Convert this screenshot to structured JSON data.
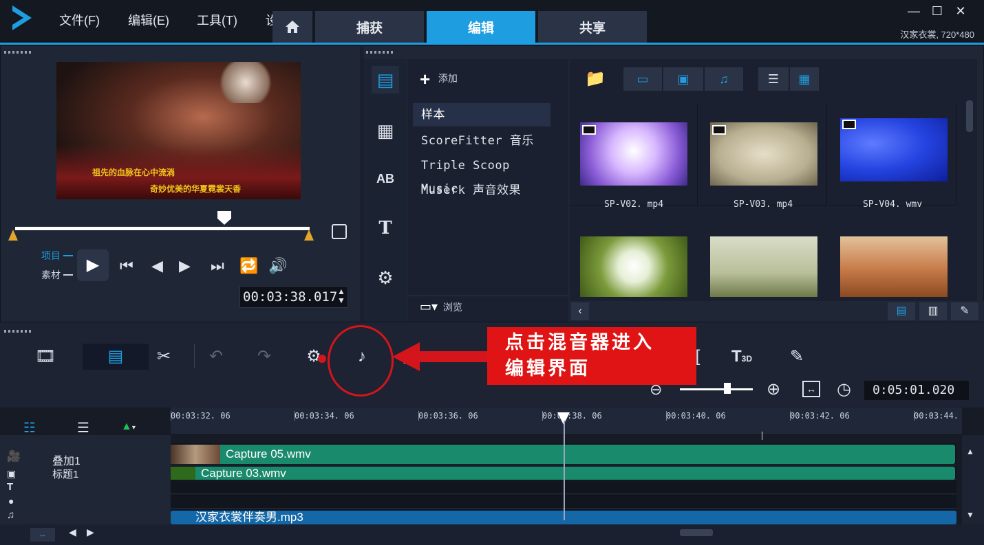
{
  "app": {
    "menu": [
      "文件(F)",
      "编辑(E)",
      "工具(T)",
      "设"
    ],
    "tabs": [
      "捕获",
      "编辑",
      "共享"
    ],
    "active_tab": "编辑",
    "project_info": "汉家衣裳, 720*480",
    "accent": "#1e9ee0"
  },
  "preview": {
    "lyrics": [
      "祖先的血脉在心中流淌",
      "奇妙优美的华夏霓裳天香"
    ],
    "mode_project": "项目",
    "mode_clip": "素材",
    "timecode": "00:03:38.017"
  },
  "library": {
    "add_label": "添加",
    "folders": [
      "样本",
      "ScoreFitter 音乐",
      "Triple Scoop Music",
      "Muserk 声音效果"
    ],
    "selected_folder": "样本",
    "browse_label": "浏览",
    "thumbnails": [
      {
        "name": "SP-V02. mp4",
        "kind": "video"
      },
      {
        "name": "SP-V03. mp4",
        "kind": "video"
      },
      {
        "name": "SP-V04. wmv",
        "kind": "video"
      },
      {
        "name": "",
        "kind": "image"
      },
      {
        "name": "",
        "kind": "image"
      },
      {
        "name": "",
        "kind": "image"
      }
    ]
  },
  "toolbar": {
    "total_time": "0:05:01.020",
    "annotation": [
      "点击混音器进入",
      "编辑界面"
    ],
    "annotation_color": "#e01414"
  },
  "timeline": {
    "ruler_ticks": [
      "00:03:32. 06",
      "00:03:34. 06",
      "00:03:36. 06",
      "00:03:38. 06",
      "00:03:40. 06",
      "00:03:42. 06",
      "00:03:44."
    ],
    "tracks": [
      {
        "name": "叠加1",
        "clip": "Capture 05.wmv"
      },
      {
        "name": "标题1",
        "clip": "Capture 03.wmv"
      },
      {
        "name": "",
        "clip": ""
      },
      {
        "name": "",
        "clip": ""
      },
      {
        "name": "",
        "clip": "汉家衣裳伴奏男.mp3"
      }
    ]
  }
}
